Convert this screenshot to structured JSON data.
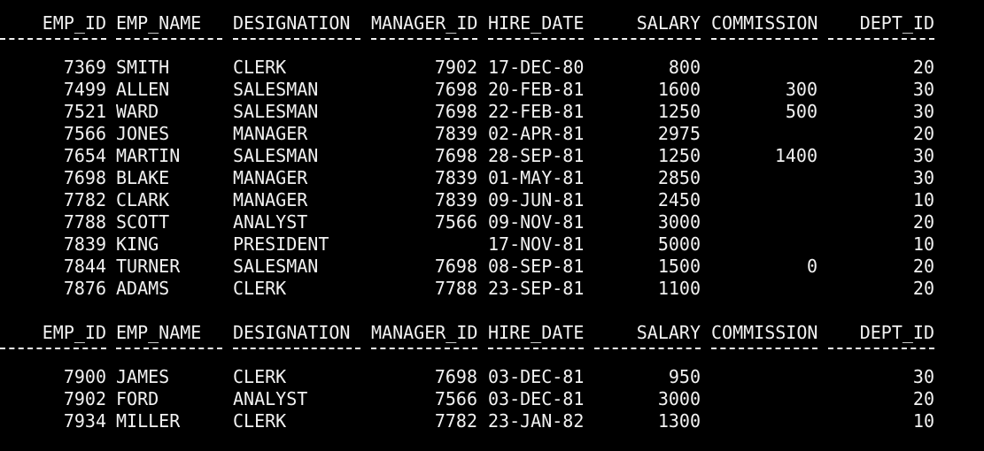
{
  "columns": [
    {
      "key": "id",
      "label": "EMP_ID",
      "align": "right"
    },
    {
      "key": "name",
      "label": "EMP_NAME",
      "align": "left"
    },
    {
      "key": "des",
      "label": "DESIGNATION",
      "align": "left"
    },
    {
      "key": "mgr",
      "label": "MANAGER_ID",
      "align": "right"
    },
    {
      "key": "hire",
      "label": "HIRE_DATE",
      "align": "left"
    },
    {
      "key": "sal",
      "label": "SALARY",
      "align": "right"
    },
    {
      "key": "comm",
      "label": "COMMISSION",
      "align": "right"
    },
    {
      "key": "dept",
      "label": "DEPT_ID",
      "align": "right"
    }
  ],
  "pages": [
    {
      "rows": [
        {
          "id": "7369",
          "name": "SMITH",
          "des": "CLERK",
          "mgr": "7902",
          "hire": "17-DEC-80",
          "sal": "800",
          "comm": "",
          "dept": "20"
        },
        {
          "id": "7499",
          "name": "ALLEN",
          "des": "SALESMAN",
          "mgr": "7698",
          "hire": "20-FEB-81",
          "sal": "1600",
          "comm": "300",
          "dept": "30"
        },
        {
          "id": "7521",
          "name": "WARD",
          "des": "SALESMAN",
          "mgr": "7698",
          "hire": "22-FEB-81",
          "sal": "1250",
          "comm": "500",
          "dept": "30"
        },
        {
          "id": "7566",
          "name": "JONES",
          "des": "MANAGER",
          "mgr": "7839",
          "hire": "02-APR-81",
          "sal": "2975",
          "comm": "",
          "dept": "20"
        },
        {
          "id": "7654",
          "name": "MARTIN",
          "des": "SALESMAN",
          "mgr": "7698",
          "hire": "28-SEP-81",
          "sal": "1250",
          "comm": "1400",
          "dept": "30"
        },
        {
          "id": "7698",
          "name": "BLAKE",
          "des": "MANAGER",
          "mgr": "7839",
          "hire": "01-MAY-81",
          "sal": "2850",
          "comm": "",
          "dept": "30"
        },
        {
          "id": "7782",
          "name": "CLARK",
          "des": "MANAGER",
          "mgr": "7839",
          "hire": "09-JUN-81",
          "sal": "2450",
          "comm": "",
          "dept": "10"
        },
        {
          "id": "7788",
          "name": "SCOTT",
          "des": "ANALYST",
          "mgr": "7566",
          "hire": "09-NOV-81",
          "sal": "3000",
          "comm": "",
          "dept": "20"
        },
        {
          "id": "7839",
          "name": "KING",
          "des": "PRESIDENT",
          "mgr": "",
          "hire": "17-NOV-81",
          "sal": "5000",
          "comm": "",
          "dept": "10"
        },
        {
          "id": "7844",
          "name": "TURNER",
          "des": "SALESMAN",
          "mgr": "7698",
          "hire": "08-SEP-81",
          "sal": "1500",
          "comm": "0",
          "dept": "20"
        },
        {
          "id": "7876",
          "name": "ADAMS",
          "des": "CLERK",
          "mgr": "7788",
          "hire": "23-SEP-81",
          "sal": "1100",
          "comm": "",
          "dept": "20"
        }
      ]
    },
    {
      "rows": [
        {
          "id": "7900",
          "name": "JAMES",
          "des": "CLERK",
          "mgr": "7698",
          "hire": "03-DEC-81",
          "sal": "950",
          "comm": "",
          "dept": "30"
        },
        {
          "id": "7902",
          "name": "FORD",
          "des": "ANALYST",
          "mgr": "7566",
          "hire": "03-DEC-81",
          "sal": "3000",
          "comm": "",
          "dept": "20"
        },
        {
          "id": "7934",
          "name": "MILLER",
          "des": "CLERK",
          "mgr": "7782",
          "hire": "23-JAN-82",
          "sal": "1300",
          "comm": "",
          "dept": "10"
        }
      ]
    }
  ]
}
